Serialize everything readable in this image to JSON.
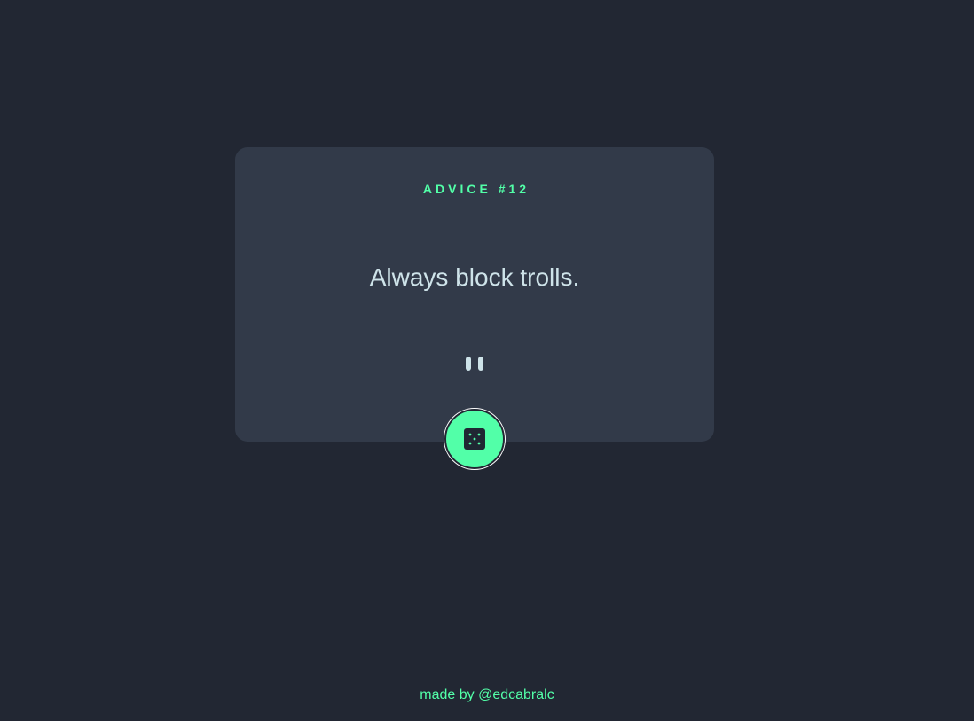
{
  "card": {
    "label": "ADVICE #12",
    "advice": "Always block trolls."
  },
  "divider": {
    "icon": "pause-icon"
  },
  "button": {
    "icon": "dice-icon"
  },
  "footer": {
    "prefix": "made by ",
    "author": "@edcabralc"
  },
  "colors": {
    "background": "#222733",
    "card": "#323a49",
    "accent": "#52ffa8",
    "text": "#cee3e9",
    "divider": "#4f5d74"
  }
}
